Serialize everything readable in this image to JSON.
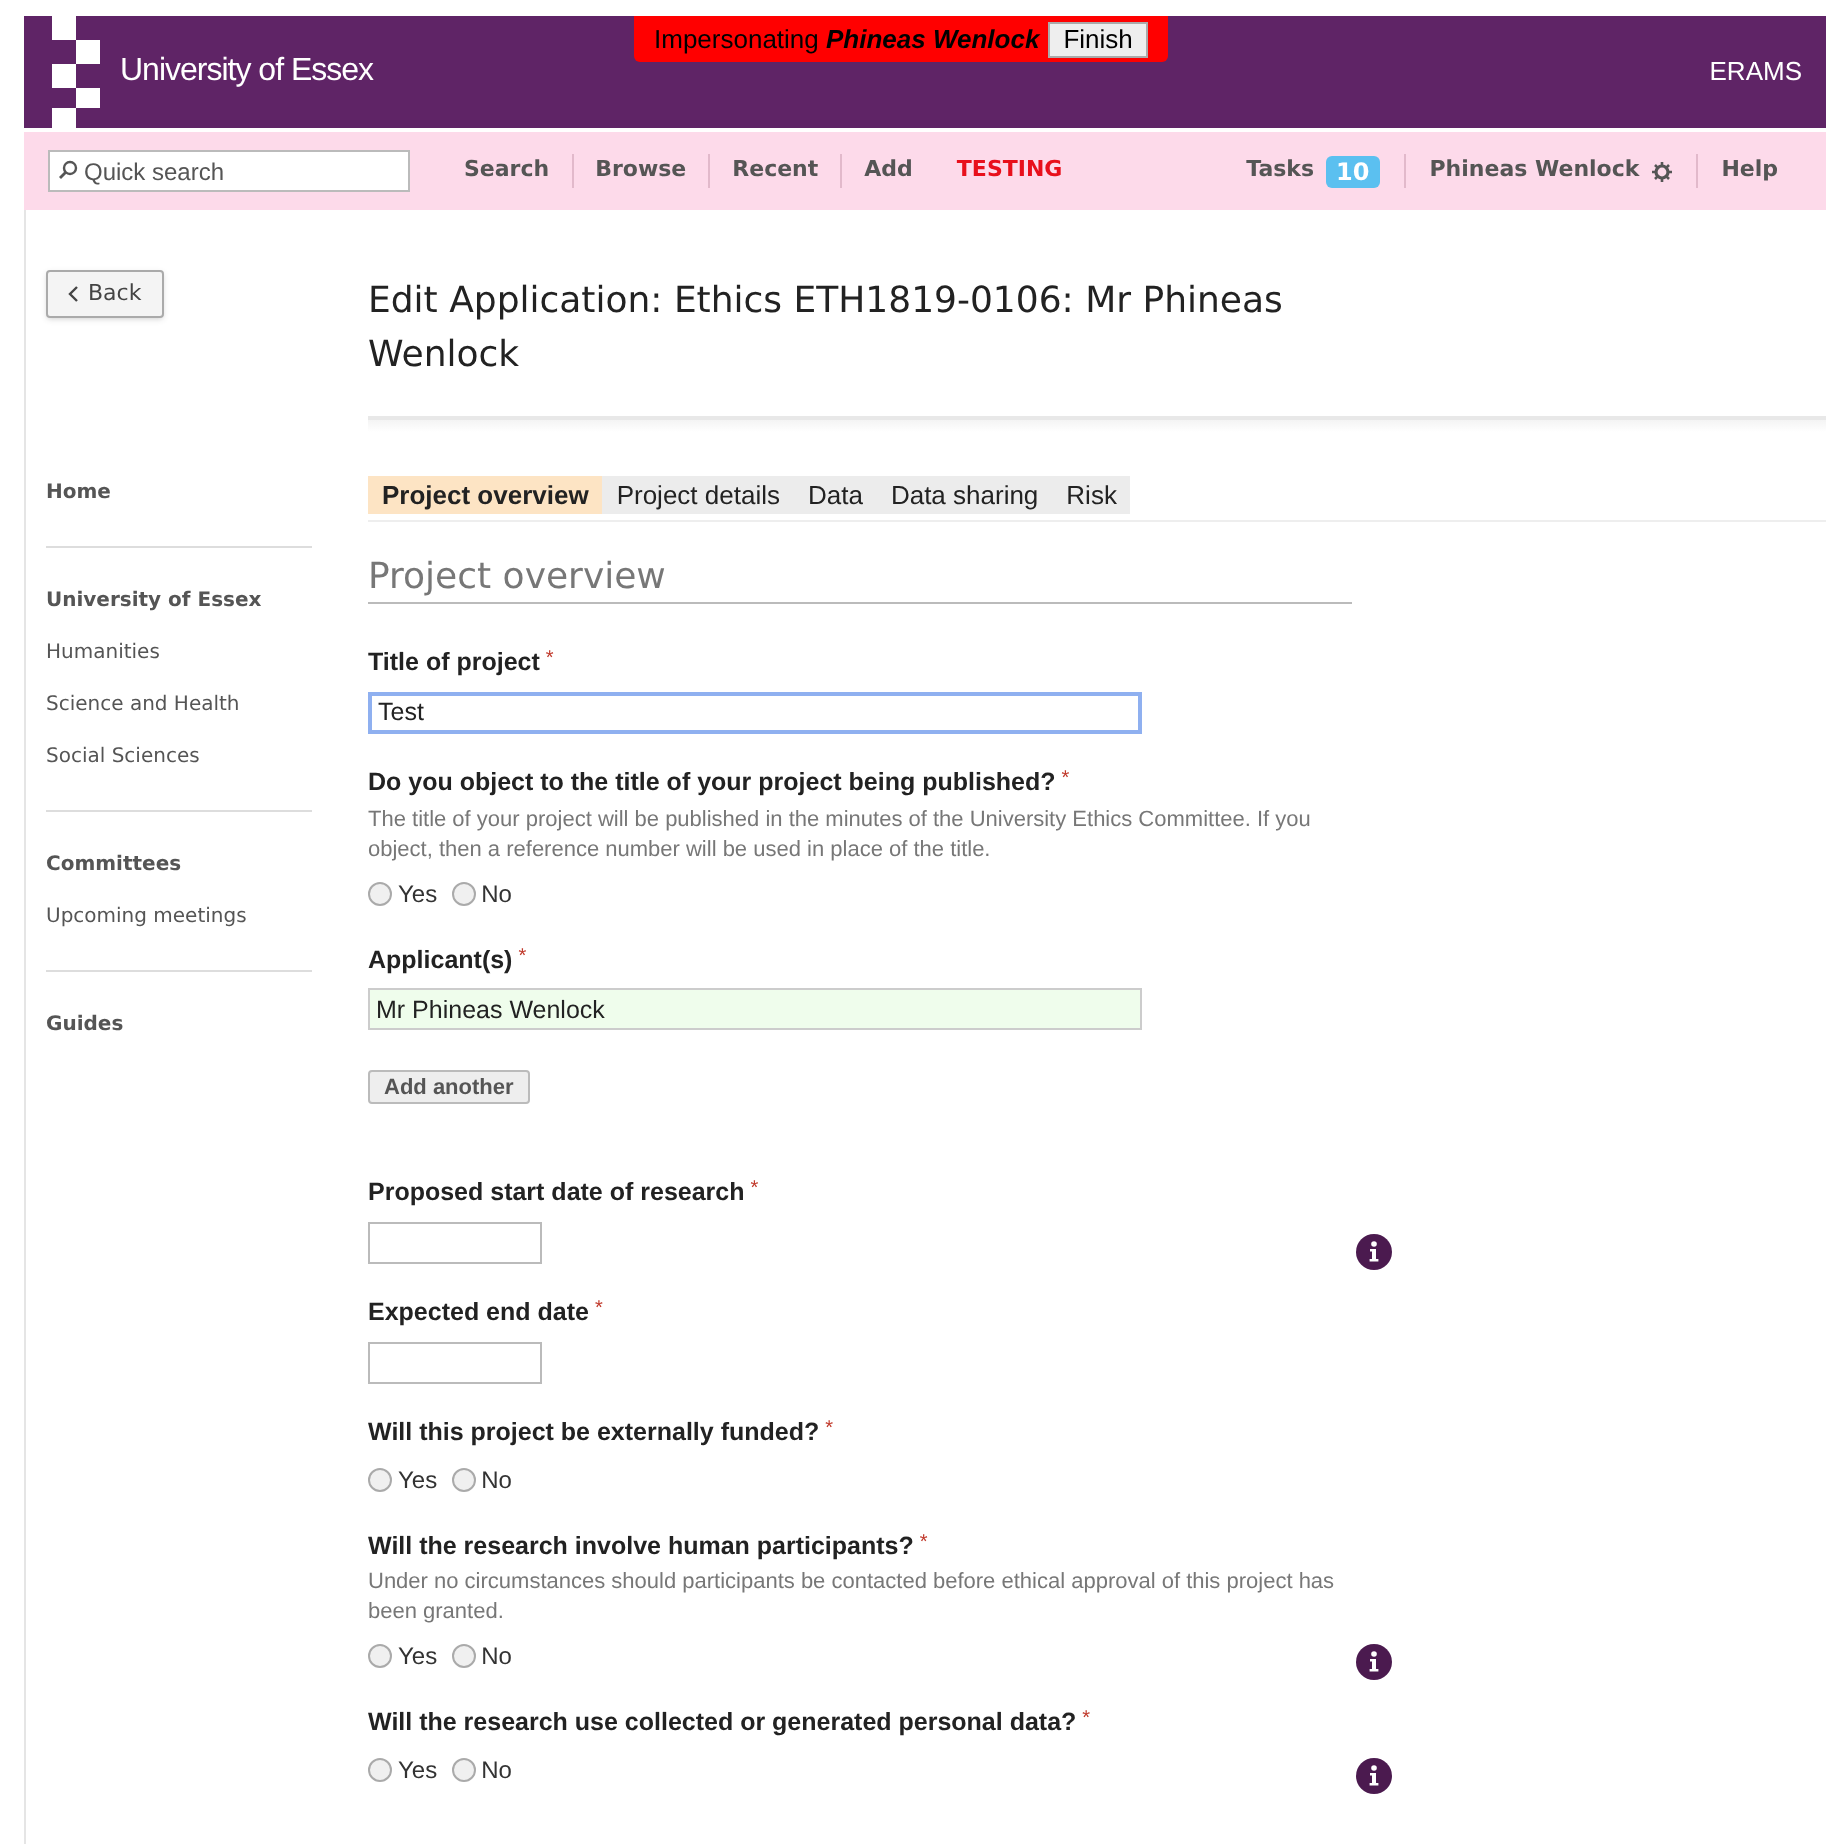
{
  "header": {
    "logo_text": "University of Essex",
    "impersonation": {
      "label": "Impersonating",
      "name": "Phineas Wenlock",
      "button": "Finish"
    },
    "app_name": "ERAMS"
  },
  "nav": {
    "search_placeholder": "Quick search",
    "links": [
      {
        "label": "Search",
        "kind": "link"
      },
      {
        "label": "Browse",
        "kind": "link"
      },
      {
        "label": "Recent",
        "kind": "link"
      },
      {
        "label": "Add",
        "kind": "link"
      },
      {
        "label": "TESTING",
        "kind": "alert"
      }
    ],
    "right": [
      {
        "label": "Tasks",
        "kind": "count",
        "count": "10"
      },
      {
        "label": "Phineas Wenlock",
        "kind": "user"
      },
      {
        "label": "Help",
        "kind": "link"
      }
    ]
  },
  "back_button": "Back",
  "sidebar": [
    {
      "items": [
        {
          "label": "Home",
          "heading": true
        }
      ]
    },
    {
      "items": [
        {
          "label": "University of Essex",
          "heading": true
        },
        {
          "label": "Humanities",
          "heading": false
        },
        {
          "label": "Science and Health",
          "heading": false
        },
        {
          "label": "Social Sciences",
          "heading": false
        }
      ]
    },
    {
      "items": [
        {
          "label": "Committees",
          "heading": true
        },
        {
          "label": "Upcoming meetings",
          "heading": false
        }
      ]
    },
    {
      "items": [
        {
          "label": "Guides",
          "heading": true
        }
      ]
    }
  ],
  "page_title": "Edit Application: Ethics ETH1819-0106: Mr Phineas Wenlock",
  "tabs": [
    {
      "label": "Project overview",
      "selected": true
    },
    {
      "label": "Project details",
      "selected": false
    },
    {
      "label": "Data",
      "selected": false
    },
    {
      "label": "Data sharing",
      "selected": false
    },
    {
      "label": "Risk",
      "selected": false
    }
  ],
  "section_title": "Project overview",
  "fields": [
    {
      "kind": "text",
      "label": "Title of project",
      "required_mark": "*",
      "value": "Test",
      "focused": true,
      "info": false
    },
    {
      "kind": "radio",
      "label": "Do you object to the title of your project being published?",
      "required_mark": "*",
      "help": "The title of your project will be published in the minutes of the University Ethics Committee. If you object, then a reference number will be used in place of the title.",
      "options": [
        {
          "label": "Yes",
          "selected": false
        },
        {
          "label": "No",
          "selected": false
        }
      ],
      "info": false
    },
    {
      "kind": "applicants",
      "label": "Applicant(s)",
      "required_mark": "*",
      "value": "Mr Phineas Wenlock",
      "focused": false,
      "button": "Add another",
      "info": false
    },
    {
      "kind": "date",
      "label": "Proposed start date of research",
      "required_mark": "*",
      "info": true
    },
    {
      "kind": "date",
      "label": "Expected end date",
      "required_mark": "*",
      "info": false
    },
    {
      "kind": "radio",
      "label": "Will this project be externally funded?",
      "required_mark": "*",
      "options": [
        {
          "label": "Yes",
          "selected": false
        },
        {
          "label": "No",
          "selected": false
        }
      ],
      "info": false
    },
    {
      "kind": "radio",
      "label": "Will the research involve human participants?",
      "required_mark": "*",
      "help": "Under no circumstances should participants be contacted before ethical approval of this project has been granted.",
      "options": [
        {
          "label": "Yes",
          "selected": false
        },
        {
          "label": "No",
          "selected": false
        }
      ],
      "info": true
    },
    {
      "kind": "radio",
      "label": "Will the research use collected or generated personal data?",
      "required_mark": "*",
      "options": [
        {
          "label": "Yes",
          "selected": false
        },
        {
          "label": "No",
          "selected": false
        }
      ],
      "info": true
    }
  ]
}
